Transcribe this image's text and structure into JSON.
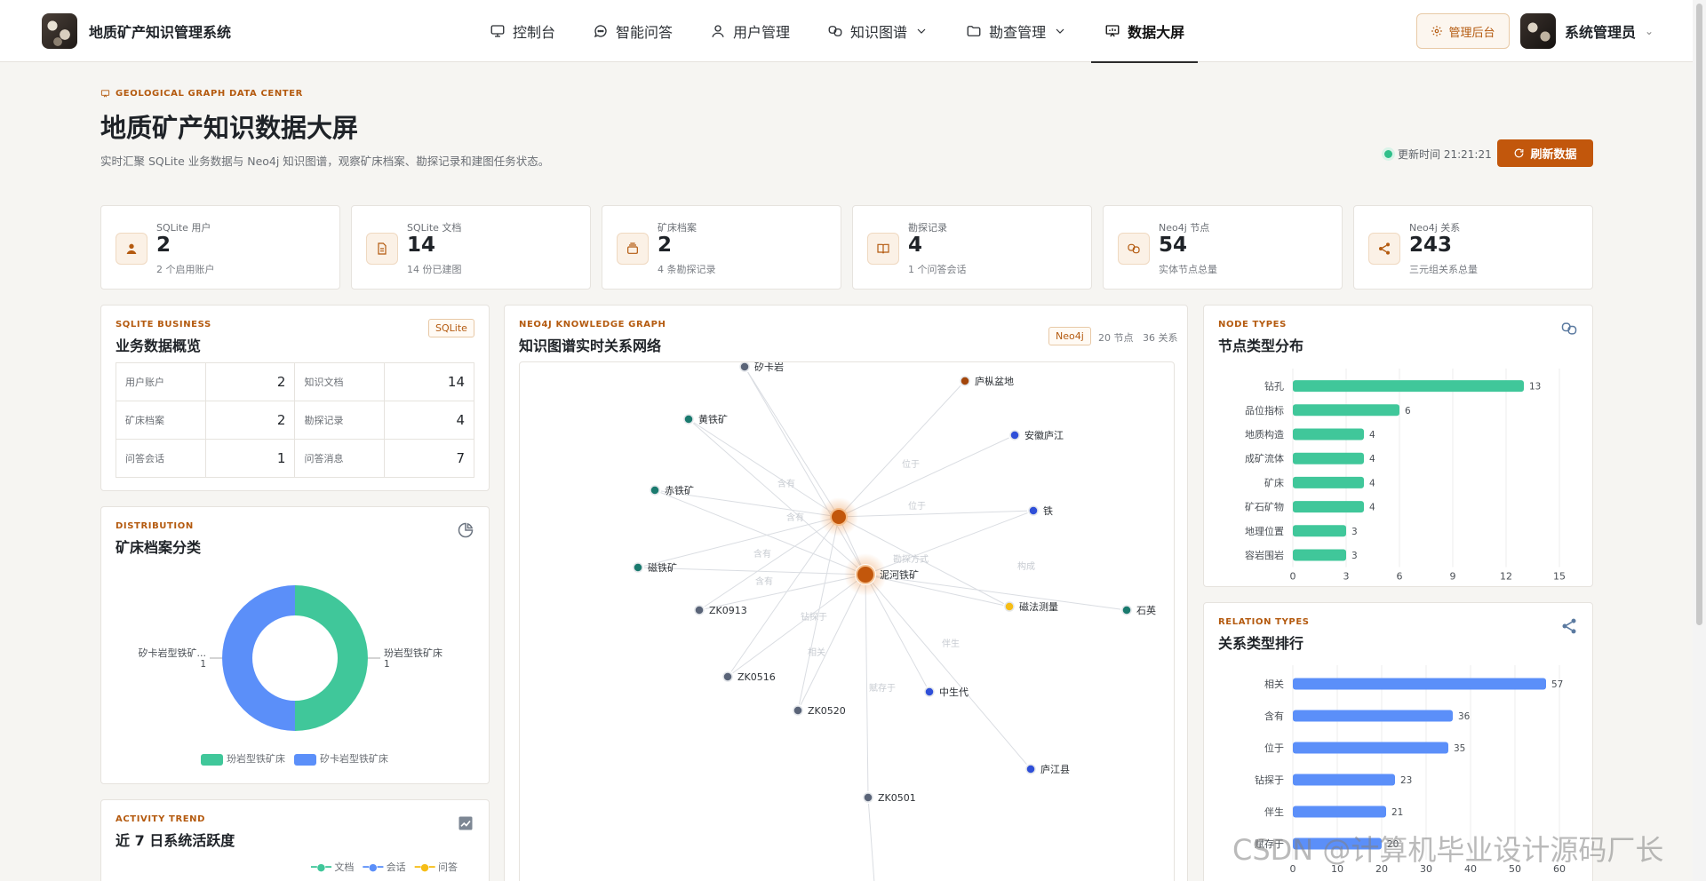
{
  "header": {
    "brand_title": "地质矿产知识管理系统",
    "nav": [
      {
        "label": "控制台",
        "icon": "monitor-icon"
      },
      {
        "label": "智能问答",
        "icon": "chat-icon"
      },
      {
        "label": "用户管理",
        "icon": "user-icon"
      },
      {
        "label": "知识图谱",
        "icon": "graph-icon",
        "dropdown": true
      },
      {
        "label": "勘查管理",
        "icon": "folder-icon",
        "dropdown": true
      },
      {
        "label": "数据大屏",
        "icon": "dashboard-icon",
        "active": true
      }
    ],
    "admin_button": "管理后台",
    "user_name": "系统管理员"
  },
  "page": {
    "kicker": "GEOLOGICAL GRAPH DATA CENTER",
    "title": "地质矿产知识数据大屏",
    "subtitle": "实时汇聚 SQLite 业务数据与 Neo4j 知识图谱，观察矿床档案、勘探记录和建图任务状态。",
    "update_time": "更新时间 21:21:21",
    "refresh_button": "刷新数据"
  },
  "stats": [
    {
      "label": "SQLite 用户",
      "value": "2",
      "sub": "2 个启用账户",
      "icon": "user-icon"
    },
    {
      "label": "SQLite 文档",
      "value": "14",
      "sub": "14 份已建图",
      "icon": "document-icon"
    },
    {
      "label": "矿床档案",
      "value": "2",
      "sub": "4 条勘探记录",
      "icon": "archive-icon"
    },
    {
      "label": "勘探记录",
      "value": "4",
      "sub": "1 个问答会话",
      "icon": "book-icon"
    },
    {
      "label": "Neo4j 节点",
      "value": "54",
      "sub": "实体节点总量",
      "icon": "nodes-icon"
    },
    {
      "label": "Neo4j 关系",
      "value": "243",
      "sub": "三元组关系总量",
      "icon": "share-icon"
    }
  ],
  "business": {
    "kicker": "SQLITE BUSINESS",
    "title": "业务数据概览",
    "tag": "SQLite",
    "rows": [
      [
        {
          "label": "用户账户",
          "value": "2"
        },
        {
          "label": "知识文档",
          "value": "14"
        }
      ],
      [
        {
          "label": "矿床档案",
          "value": "2"
        },
        {
          "label": "勘探记录",
          "value": "4"
        }
      ],
      [
        {
          "label": "问答会话",
          "value": "1"
        },
        {
          "label": "问答消息",
          "value": "7"
        }
      ]
    ]
  },
  "distribution": {
    "kicker": "DISTRIBUTION",
    "title": "矿床档案分类",
    "left_label": "矽卡岩型铁矿...",
    "left_value": "1",
    "right_label": "玢岩型铁矿床",
    "right_value": "1",
    "legend": [
      "玢岩型铁矿床",
      "矽卡岩型铁矿床"
    ]
  },
  "activity": {
    "kicker": "ACTIVITY TREND",
    "title": "近 7 日系统活跃度",
    "legend": [
      "文档",
      "会话",
      "问答"
    ]
  },
  "graph": {
    "kicker": "NEO4J KNOWLEDGE GRAPH",
    "title": "知识图谱实时关系网络",
    "tag": "Neo4j",
    "nodes_count": "20 节点",
    "rels_count": "36 关系",
    "nodes": [
      "矽卡岩",
      "庐枞盆地",
      "黄铁矿",
      "安徽庐江",
      "赤铁矿",
      "铁",
      "磁铁矿",
      "泥河铁矿",
      "ZK0913",
      "磁法测量",
      "石英",
      "ZK0516",
      "中生代",
      "ZK0520",
      "庐江县",
      "ZK0501"
    ],
    "edge_labels": [
      "含有",
      "含有",
      "含有",
      "含有",
      "位于",
      "位于",
      "勘探方式",
      "钻探于",
      "相关",
      "构成",
      "伴生",
      "赋存于"
    ]
  },
  "colors": {
    "accent": "#c2570c",
    "green": "#40c79a",
    "blue": "#5b8ff9",
    "yellow": "#f6bd16",
    "teal_node": "#1a7a6e",
    "grey_node": "#5a6478",
    "blue_node": "#2f4fd8"
  },
  "node_types": {
    "kicker": "NODE TYPES",
    "title": "节点类型分布"
  },
  "relation_types": {
    "kicker": "RELATION TYPES",
    "title": "关系类型排行"
  },
  "chart_data": [
    {
      "type": "bar",
      "orientation": "horizontal",
      "title": "节点类型分布",
      "categories": [
        "钻孔",
        "品位指标",
        "地质构造",
        "成矿流体",
        "矿床",
        "矿石矿物",
        "地理位置",
        "容岩围岩"
      ],
      "values": [
        13,
        6,
        4,
        4,
        4,
        4,
        3,
        3
      ],
      "xlim": [
        0,
        15
      ],
      "xticks": [
        "0",
        "3",
        "6",
        "9",
        "12",
        "15"
      ],
      "color": "#40c79a"
    },
    {
      "type": "bar",
      "orientation": "horizontal",
      "title": "关系类型排行",
      "categories": [
        "相关",
        "含有",
        "位于",
        "钻探于",
        "伴生",
        "赋存于"
      ],
      "values": [
        57,
        36,
        35,
        23,
        21,
        20
      ],
      "xlim": [
        0,
        60
      ],
      "xticks": [
        "0",
        "10",
        "20",
        "30",
        "40",
        "50",
        "60"
      ],
      "color": "#5b8ff9"
    },
    {
      "type": "pie",
      "title": "矿床档案分类",
      "categories": [
        "玢岩型铁矿床",
        "矽卡岩型铁矿床"
      ],
      "values": [
        1,
        1
      ],
      "colors": [
        "#40c79a",
        "#5b8ff9"
      ]
    }
  ],
  "watermark": "CSDN @计算机毕业设计源码厂长"
}
